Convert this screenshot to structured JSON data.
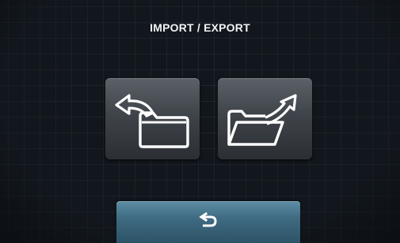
{
  "screen": {
    "title": "IMPORT / EXPORT"
  },
  "tiles": [
    {
      "action": "import",
      "icon": "folder-import-icon"
    },
    {
      "action": "export",
      "icon": "folder-export-icon"
    }
  ],
  "footer": {
    "back_icon": "back-arrow-icon"
  },
  "colors": {
    "background": "#12171d",
    "tile": "#4a4f55",
    "back_button": "#3f6b82",
    "icon": "#ffffff"
  }
}
